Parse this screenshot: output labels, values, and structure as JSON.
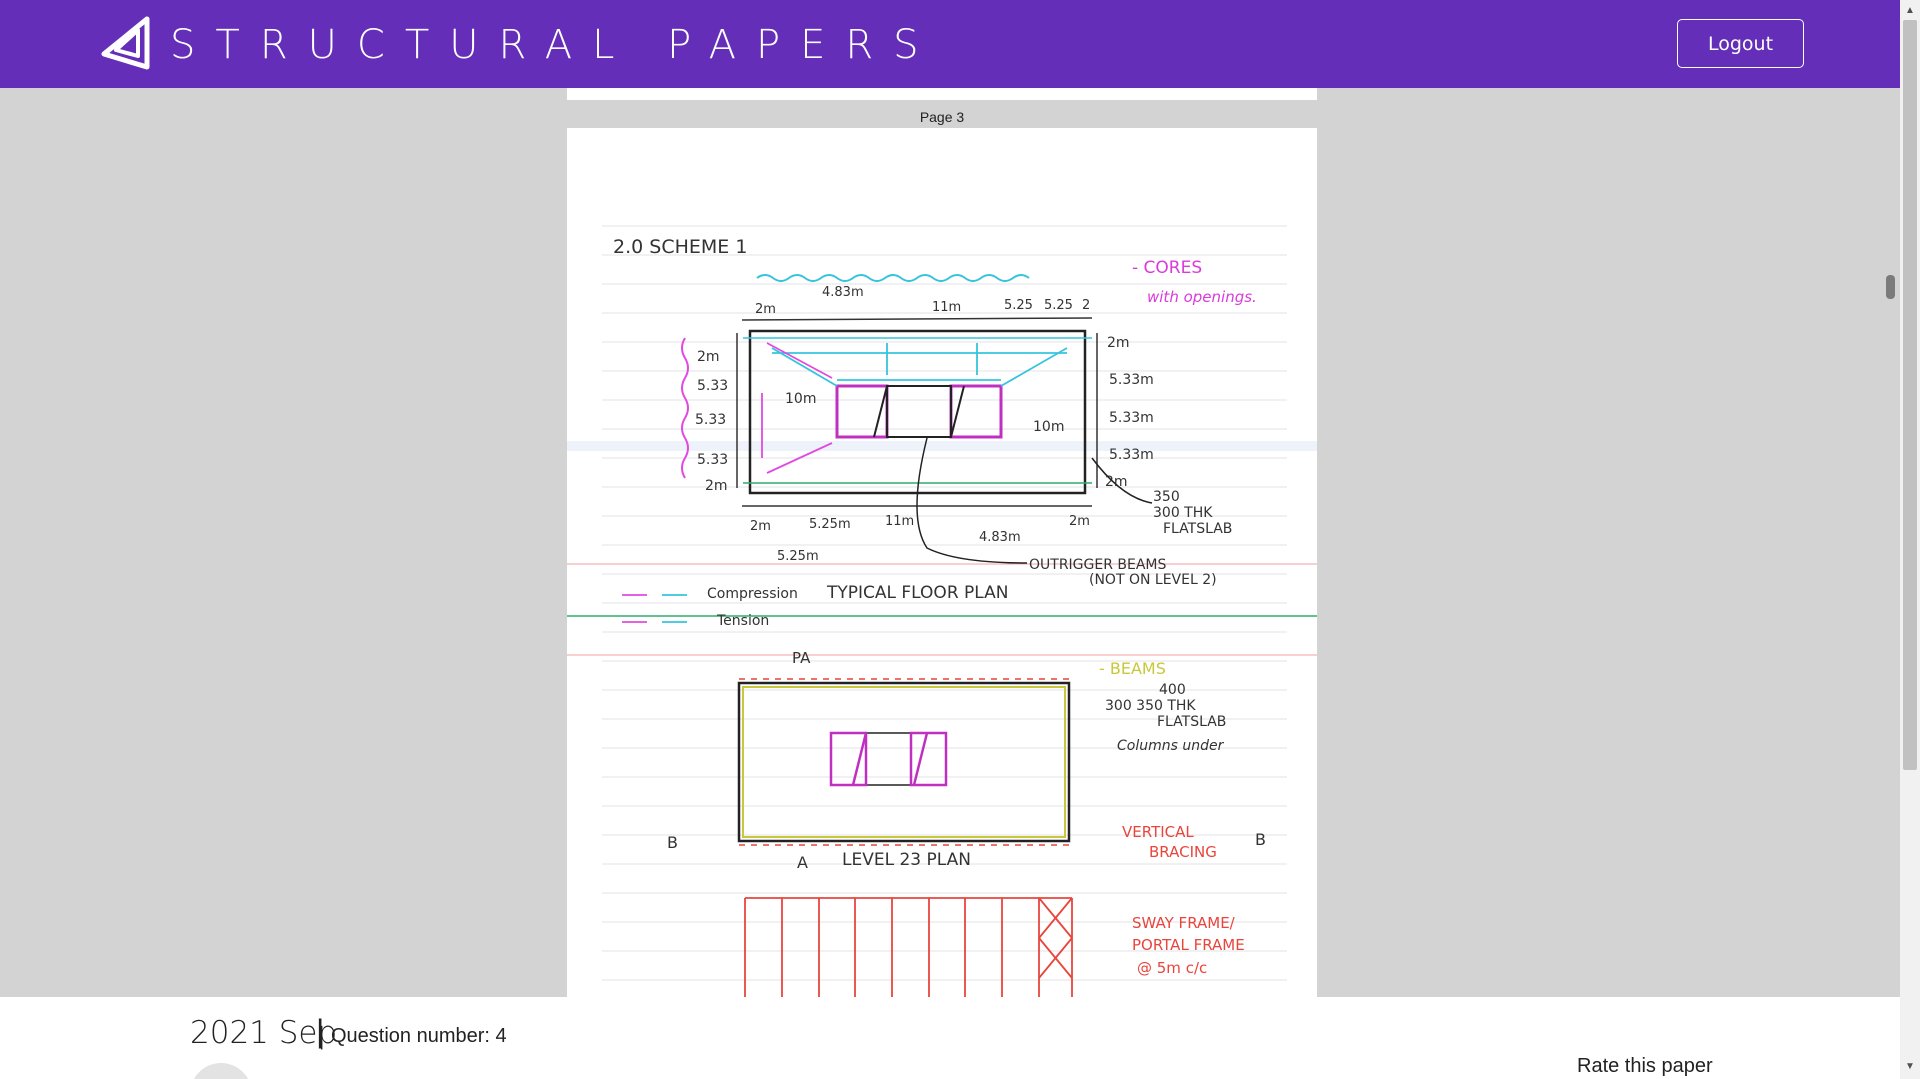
{
  "header": {
    "brand": "STRUCTURAL PAPERS",
    "logout_label": "Logout"
  },
  "viewer": {
    "page_label": "Page 3"
  },
  "sketch": {
    "scheme_title": "2.0 SCHEME 1",
    "cores_note_1": "- CORES",
    "cores_note_2": "with openings.",
    "top_dims": [
      "2m",
      "4.83m",
      "11m",
      "5.25",
      "5.25",
      "2"
    ],
    "top_left_dims": [
      "2m",
      "5.33",
      "5.33",
      "5.33",
      "2m"
    ],
    "right_dims": [
      "2m",
      "5.33m",
      "5.33m",
      "5.33m",
      "2m"
    ],
    "inner_left": "10m",
    "inner_right": "10m",
    "bottom_dims": [
      "2m",
      "5.25m",
      "11m",
      "4.83m",
      "2m",
      "5.25m"
    ],
    "slab_note": [
      "350",
      "300 THK",
      "FLATSLAB"
    ],
    "outrigger_note_1": "OUTRIGGER BEAMS",
    "outrigger_note_2": "(NOT ON LEVEL 2)",
    "legend_compression": "Compression",
    "legend_tension": "Tension",
    "floor_plan_title": "TYPICAL FLOOR PLAN",
    "pa_label": "PA",
    "beams_note": "- BEAMS",
    "slab2_note": [
      "400",
      "300 350 THK",
      "FLATSLAB"
    ],
    "columns_note": "Columns under",
    "bracing_note_1": "VERTICAL",
    "bracing_note_2": "BRACING",
    "b_label_left": "B",
    "b_label_right": "B",
    "pa_label_bottom": "A",
    "level_plan_title": "LEVEL 23 PLAN",
    "sway_note_1": "SWAY FRAME/",
    "sway_note_2": "PORTAL FRAME",
    "sway_note_3": "@ 5m c/c"
  },
  "footer": {
    "date_heading": "2021 Sep",
    "separator": "|",
    "question_number": "Question number: 4",
    "rate_label": "Rate this paper"
  },
  "colors": {
    "brand": "#652eb8",
    "magenta": "#d93bd9",
    "cyan": "#35c4dd",
    "red": "#e8453c",
    "yellow": "#c8c83a"
  }
}
